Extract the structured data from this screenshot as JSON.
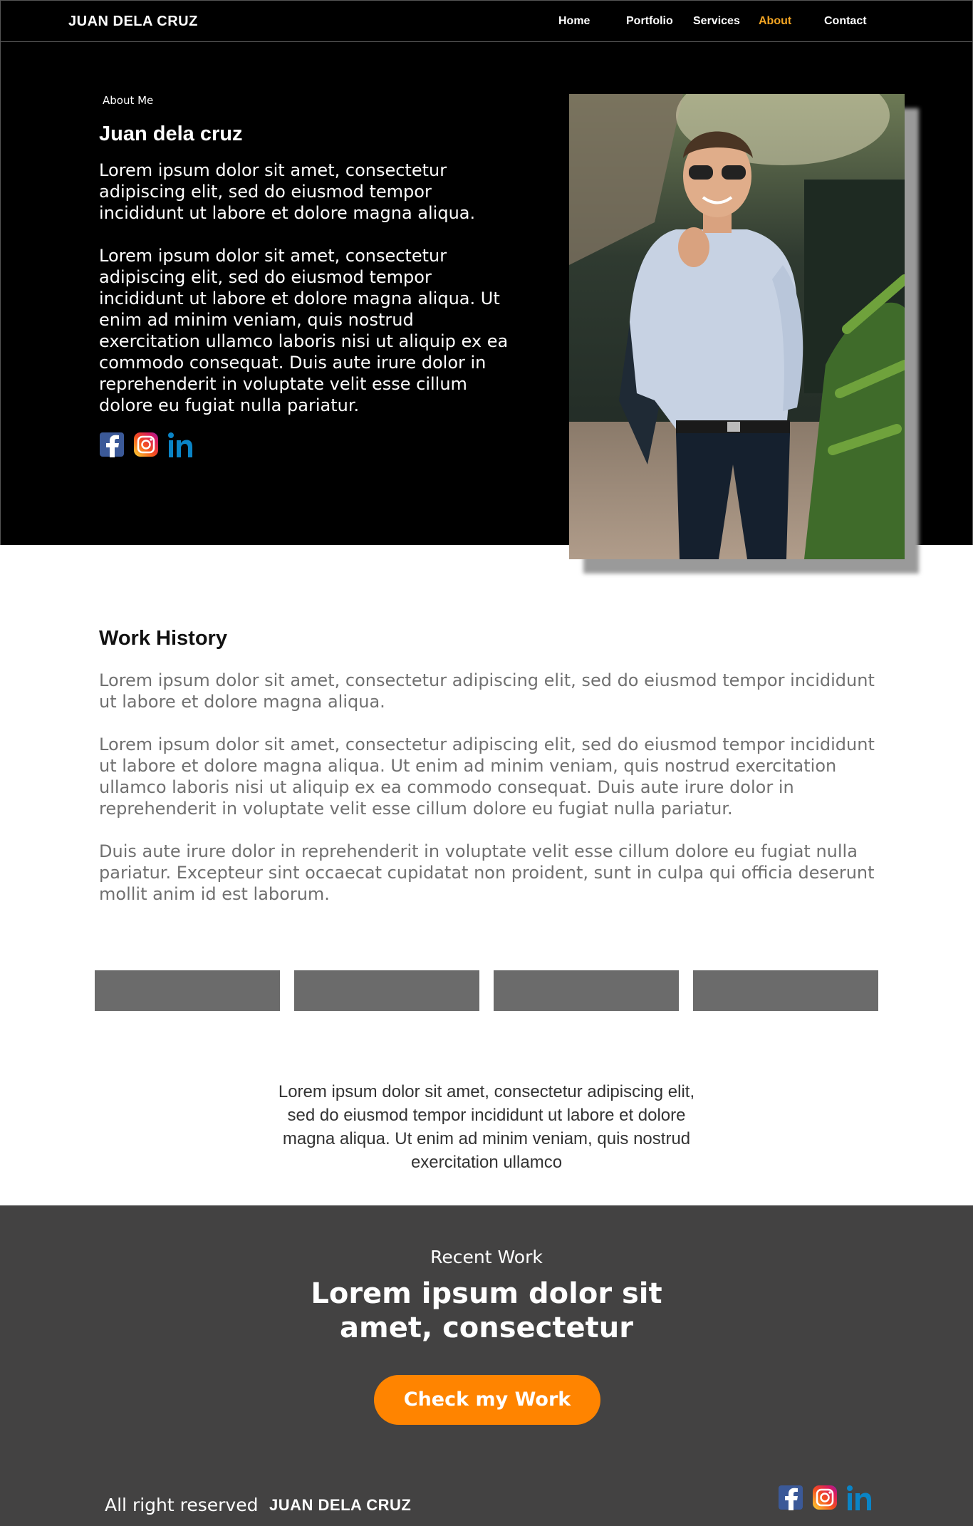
{
  "nav": {
    "brand": "JUAN DELA CRUZ",
    "links": [
      {
        "label": "Home"
      },
      {
        "label": "Portfolio"
      },
      {
        "label": "Services"
      },
      {
        "label": "About"
      },
      {
        "label": "Contact"
      }
    ],
    "active": "About"
  },
  "hero": {
    "kicker": "About Me",
    "title": "Juan dela cruz",
    "paragraph1": "Lorem ipsum dolor sit amet, consectetur adipiscing elit, sed do eiusmod tempor incididunt ut labore et dolore magna aliqua.",
    "paragraph2": "Lorem ipsum dolor sit amet, consectetur adipiscing elit, sed do eiusmod tempor incididunt ut labore et dolore magna aliqua. Ut enim ad minim veniam, quis nostrud exercitation ullamco laboris nisi ut aliquip ex ea commodo consequat. Duis aute irure dolor in reprehenderit in voluptate velit esse cillum dolore eu fugiat nulla pariatur.",
    "social_icons": [
      "facebook-icon",
      "instagram-icon",
      "linkedin-icon"
    ]
  },
  "work_history": {
    "title": "Work History",
    "paragraph1": "Lorem ipsum dolor sit amet, consectetur adipiscing elit, sed do eiusmod tempor incididunt ut labore et dolore magna aliqua.",
    "paragraph2": "Lorem ipsum dolor sit amet, consectetur adipiscing elit, sed do eiusmod tempor incididunt ut labore et dolore magna aliqua. Ut enim ad minim veniam, quis nostrud exercitation ullamco laboris nisi ut aliquip ex ea commodo consequat. Duis aute irure dolor in reprehenderit in voluptate velit esse cillum dolore eu fugiat nulla pariatur.",
    "paragraph3": "Duis aute irure dolor in reprehenderit in voluptate velit esse cillum dolore eu fugiat nulla pariatur. Excepteur sint occaecat cupidatat non proident, sunt in culpa qui officia deserunt mollit anim id est laborum.",
    "tiles_count": 4
  },
  "quote": "Lorem ipsum dolor sit amet, consectetur adipiscing elit, sed do eiusmod tempor incididunt ut labore et dolore magna aliqua. Ut enim ad minim veniam, quis nostrud exercitation ullamco",
  "footer": {
    "kicker": "Recent Work",
    "headline": "Lorem ipsum dolor sit amet, consectetur",
    "cta": "Check my Work",
    "copyright": "All right reserved",
    "brand": "JUAN DELA CRUZ"
  },
  "colors": {
    "accent": "#f5a623",
    "cta": "#ff8400",
    "footer_bg": "#434242",
    "tile": "#6b6b6b"
  }
}
